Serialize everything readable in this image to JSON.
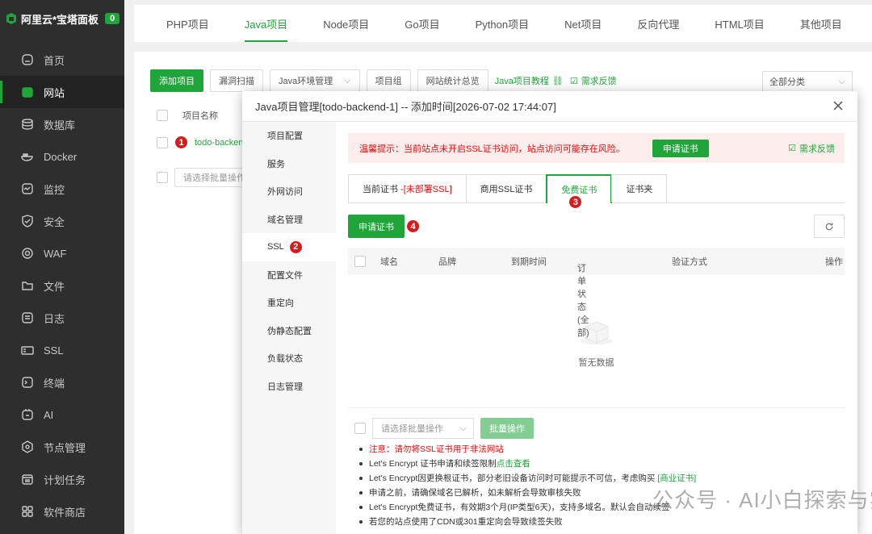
{
  "brand": {
    "title": "阿里云*宝塔面板",
    "badge": "0"
  },
  "sidebar": {
    "items": [
      {
        "label": "首页",
        "icon": "home-icon"
      },
      {
        "label": "网站",
        "icon": "globe-icon",
        "active": true
      },
      {
        "label": "数据库",
        "icon": "database-icon"
      },
      {
        "label": "Docker",
        "icon": "docker-icon"
      },
      {
        "label": "监控",
        "icon": "monitor-icon"
      },
      {
        "label": "安全",
        "icon": "shield-icon"
      },
      {
        "label": "WAF",
        "icon": "waf-icon"
      },
      {
        "label": "文件",
        "icon": "folder-icon"
      },
      {
        "label": "日志",
        "icon": "log-icon"
      },
      {
        "label": "SSL",
        "icon": "ssl-icon"
      },
      {
        "label": "终端",
        "icon": "terminal-icon"
      },
      {
        "label": "AI",
        "icon": "ai-icon"
      },
      {
        "label": "节点管理",
        "icon": "node-icon"
      },
      {
        "label": "计划任务",
        "icon": "calendar-icon"
      },
      {
        "label": "软件商店",
        "icon": "store-icon"
      }
    ]
  },
  "topTabs": [
    "PHP项目",
    "Java项目",
    "Node项目",
    "Go项目",
    "Python项目",
    "Net项目",
    "反向代理",
    "HTML项目",
    "其他项目"
  ],
  "toolbar": {
    "add": "添加项目",
    "scan": "漏洞扫描",
    "env": "Java环境管理",
    "group": "项目组",
    "stats": "网站统计总览",
    "tutorial": "Java项目教程",
    "feedback": "需求反馈",
    "category": "全部分类"
  },
  "bgTable": {
    "col_name": "项目名称",
    "row_name": "todo-backend",
    "batch_placeholder": "请选择批量操作"
  },
  "modal": {
    "title": "Java项目管理[todo-backend-1] -- 添加时间[2026-07-02 17:44:07]",
    "menu": [
      "项目配置",
      "服务",
      "外网访问",
      "域名管理",
      "SSL",
      "配置文件",
      "重定向",
      "伪静态配置",
      "负载状态",
      "日志管理"
    ],
    "alert": {
      "text": "温馨提示：当前站点未开启SSL证书访问，站点访问可能存在风险。",
      "button": "申请证书",
      "feedback": "需求反馈"
    },
    "tabs": {
      "current": "当前证书 -",
      "current_status": "[未部署SSL]",
      "commercial": "商用SSL证书",
      "free": "免费证书",
      "folder": "证书夹"
    },
    "apply_button": "申请证书",
    "table": {
      "domain": "域名",
      "brand": "品牌",
      "expire": "到期时间",
      "order_status": "订单状态(全部)",
      "verify": "验证方式",
      "action": "操作"
    },
    "empty": "暂无数据",
    "batch": {
      "placeholder": "请选择批量操作",
      "button": "批量操作"
    },
    "notes": [
      {
        "text": "注意：请勿将SSL证书用于非法网站",
        "warn": true
      },
      {
        "pre": "Let's Encrypt 证书申请和续签限制",
        "link": "点击查看",
        "post": ""
      },
      {
        "pre": "Let's Encrypt因更换根证书，部分老旧设备访问时可能提示不可信，考虑购买",
        "link": "[商业证书]",
        "post": ""
      },
      {
        "text": "申请之前，请确保域名已解析，如未解析会导致审核失败"
      },
      {
        "text": "Let's Encrypt免费证书，有效期3个月(IP类型6天)，支持多域名。默认会自动续签"
      },
      {
        "text": "若您的站点使用了CDN或301重定向会导致续签失败"
      }
    ]
  },
  "markers": [
    "1",
    "2",
    "3",
    "4"
  ],
  "watermark": "公众号 · AI小白探索与实践",
  "colors": {
    "accent": "#20a53a",
    "danger": "#ef0808",
    "marker": "#d71a1b",
    "sidebar_bg": "#2e2e2e"
  }
}
